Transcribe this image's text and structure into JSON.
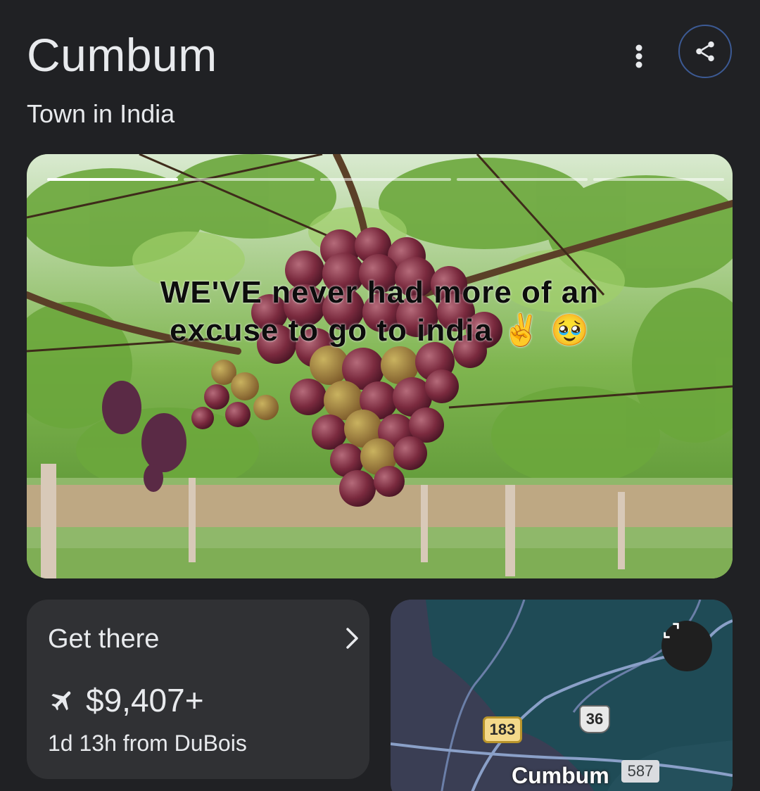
{
  "header": {
    "title": "Cumbum",
    "subtitle": "Town in India",
    "more_icon": "more-vert-icon",
    "share_icon": "share-icon",
    "share_border_color": "#3c5a94"
  },
  "hero": {
    "overlay_line1": "WE'VE never had more of an",
    "overlay_line2": "excuse to go to india ✌️ 🥹",
    "story_segments": 5,
    "active_segment": 1
  },
  "get_there": {
    "label": "Get there",
    "chevron_icon": "chevron-right-icon",
    "flight_icon": "flight-icon",
    "price": "$9,407+",
    "travel_info": "1d 13h from DuBois"
  },
  "map": {
    "expand_icon": "open-in-full-icon",
    "route_183": "183",
    "route_36": "36",
    "route_587": "587",
    "city": "Cumbum"
  }
}
